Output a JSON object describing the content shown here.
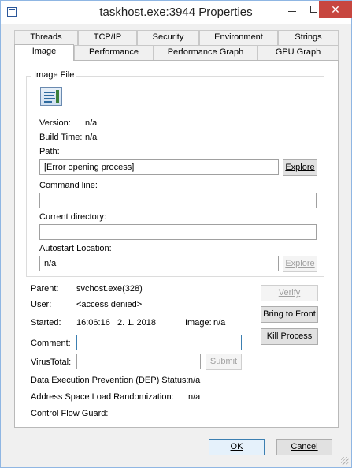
{
  "window": {
    "title": "taskhost.exe:3944 Properties",
    "close_glyph": "✕"
  },
  "tabs": {
    "row1": [
      "Threads",
      "TCP/IP",
      "Security",
      "Environment",
      "Strings"
    ],
    "row2": [
      "Image",
      "Performance",
      "Performance Graph",
      "GPU Graph"
    ],
    "active": "Image"
  },
  "image_file": {
    "group_label": "Image File",
    "version_label": "Version:",
    "version_value": "n/a",
    "build_time_label": "Build Time:",
    "build_time_value": "n/a",
    "path_label": "Path:",
    "path_value": "[Error opening process]",
    "explore_label": "Explore",
    "command_line_label": "Command line:",
    "command_line_value": "",
    "current_directory_label": "Current directory:",
    "current_directory_value": "",
    "autostart_label": "Autostart Location:",
    "autostart_value": "n/a",
    "autostart_explore_label": "Explore"
  },
  "process": {
    "parent_label": "Parent:",
    "parent_value": "svchost.exe(328)",
    "user_label": "User:",
    "user_value": "<access denied>",
    "started_label": "Started:",
    "started_time": "16:06:16",
    "started_date": "2. 1. 2018",
    "image_label": "Image:",
    "image_value": "n/a",
    "comment_label": "Comment:",
    "comment_value": "",
    "virustotal_label": "VirusTotal:",
    "virustotal_value": "",
    "submit_label": "Submit",
    "dep_label": "Data Execution Prevention (DEP) Status:",
    "dep_value": "n/a",
    "aslr_label": "Address Space Load Randomization:",
    "aslr_value": "n/a",
    "cfg_label": "Control Flow Guard:",
    "cfg_value": ""
  },
  "actions": {
    "verify_label": "Verify",
    "bring_to_front_label": "Bring to Front",
    "kill_process_label": "Kill Process"
  },
  "footer": {
    "ok_label": "OK",
    "cancel_label": "Cancel"
  }
}
